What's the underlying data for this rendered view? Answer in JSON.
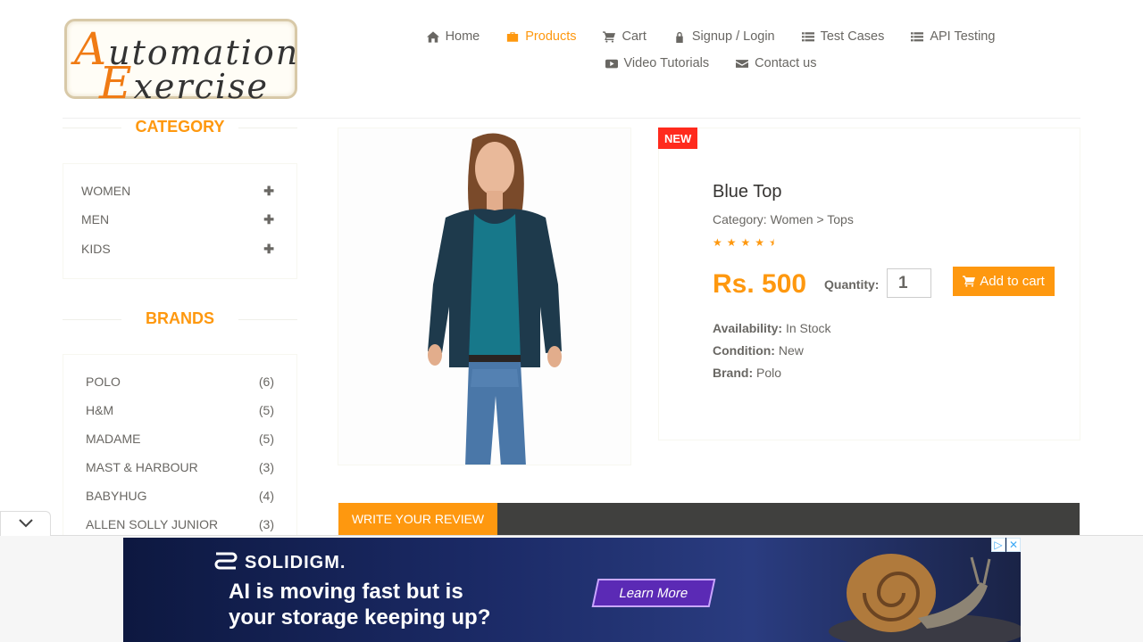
{
  "logo": {
    "line1_first": "A",
    "line1_rest": "utomation",
    "line2_first": "E",
    "line2_rest": "xercise"
  },
  "nav": {
    "row1": [
      {
        "label": "Home",
        "icon": "home-icon"
      },
      {
        "label": "Products",
        "icon": "briefcase-icon",
        "active": true
      },
      {
        "label": "Cart",
        "icon": "cart-icon"
      },
      {
        "label": "Signup / Login",
        "icon": "lock-icon"
      },
      {
        "label": "Test Cases",
        "icon": "list-icon"
      },
      {
        "label": "API Testing",
        "icon": "list-icon"
      }
    ],
    "row2": [
      {
        "label": "Video Tutorials",
        "icon": "youtube-icon"
      },
      {
        "label": "Contact us",
        "icon": "envelope-icon"
      }
    ]
  },
  "category": {
    "title": "CATEGORY",
    "items": [
      {
        "label": "WOMEN"
      },
      {
        "label": "MEN"
      },
      {
        "label": "KIDS"
      }
    ]
  },
  "brands": {
    "title": "BRANDS",
    "items": [
      {
        "label": "POLO",
        "count": "(6)"
      },
      {
        "label": "H&M",
        "count": "(5)"
      },
      {
        "label": "MADAME",
        "count": "(5)"
      },
      {
        "label": "MAST & HARBOUR",
        "count": "(3)"
      },
      {
        "label": "BABYHUG",
        "count": "(4)"
      },
      {
        "label": "ALLEN SOLLY JUNIOR",
        "count": "(3)"
      }
    ]
  },
  "product": {
    "badge": "NEW",
    "name": "Blue Top",
    "category": "Category: Women > Tops",
    "rating": 4.5,
    "price": "Rs. 500",
    "quantity_label": "Quantity:",
    "quantity_value": "1",
    "add_to_cart": "Add to cart",
    "availability_label": "Availability:",
    "availability_value": "In Stock",
    "condition_label": "Condition:",
    "condition_value": "New",
    "brand_label": "Brand:",
    "brand_value": "Polo"
  },
  "review": {
    "tab_label": "WRITE YOUR REVIEW"
  },
  "ad": {
    "brand": "SOLIDIGM.",
    "line1": "AI is moving fast but is",
    "line2": "your storage keeping up?",
    "cta": "Learn More"
  },
  "colors": {
    "accent": "#fe980f",
    "badge": "#ff2a1d",
    "text": "#696763",
    "review_bar": "#40403e"
  }
}
